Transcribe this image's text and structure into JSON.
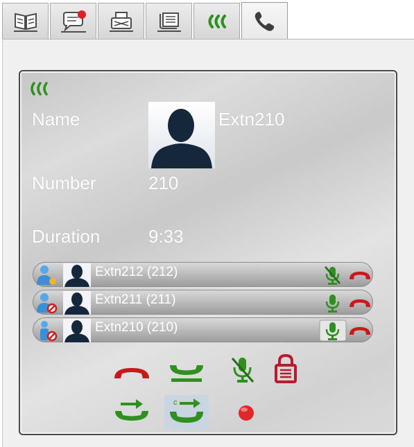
{
  "tabs": [
    {
      "icon": "phonebook-icon"
    },
    {
      "icon": "chat-message-icon"
    },
    {
      "icon": "fax-icon"
    },
    {
      "icon": "call-log-icon"
    },
    {
      "icon": "conference-icon"
    },
    {
      "icon": "phone-icon",
      "active": true
    }
  ],
  "call": {
    "name_label": "Name",
    "name_value": "Extn210",
    "number_label": "Number",
    "number_value": "210",
    "duration_label": "Duration",
    "duration_value": "9:33"
  },
  "participants": [
    {
      "label": "Extn212 (212)",
      "state_icon": "speaker-participant-icon",
      "muted": true
    },
    {
      "label": "Extn211 (211)",
      "state_icon": "blocked-participant-icon",
      "muted": false
    },
    {
      "label": "Extn210 (210)",
      "state_icon": "host-blocked-participant-icon",
      "muted": false,
      "mute_pressed": true
    }
  ],
  "controls": {
    "row1": [
      "hang-up-icon",
      "hold-icon",
      "mute-icon",
      "lock-icon"
    ],
    "row2": [
      "transfer-icon",
      "consult-transfer-icon",
      "record-icon"
    ]
  },
  "colors": {
    "accent_green": "#2f8f1f",
    "hangup_red": "#c81a1a",
    "lock_red": "#b51c2c",
    "label_white": "#ffffff"
  }
}
